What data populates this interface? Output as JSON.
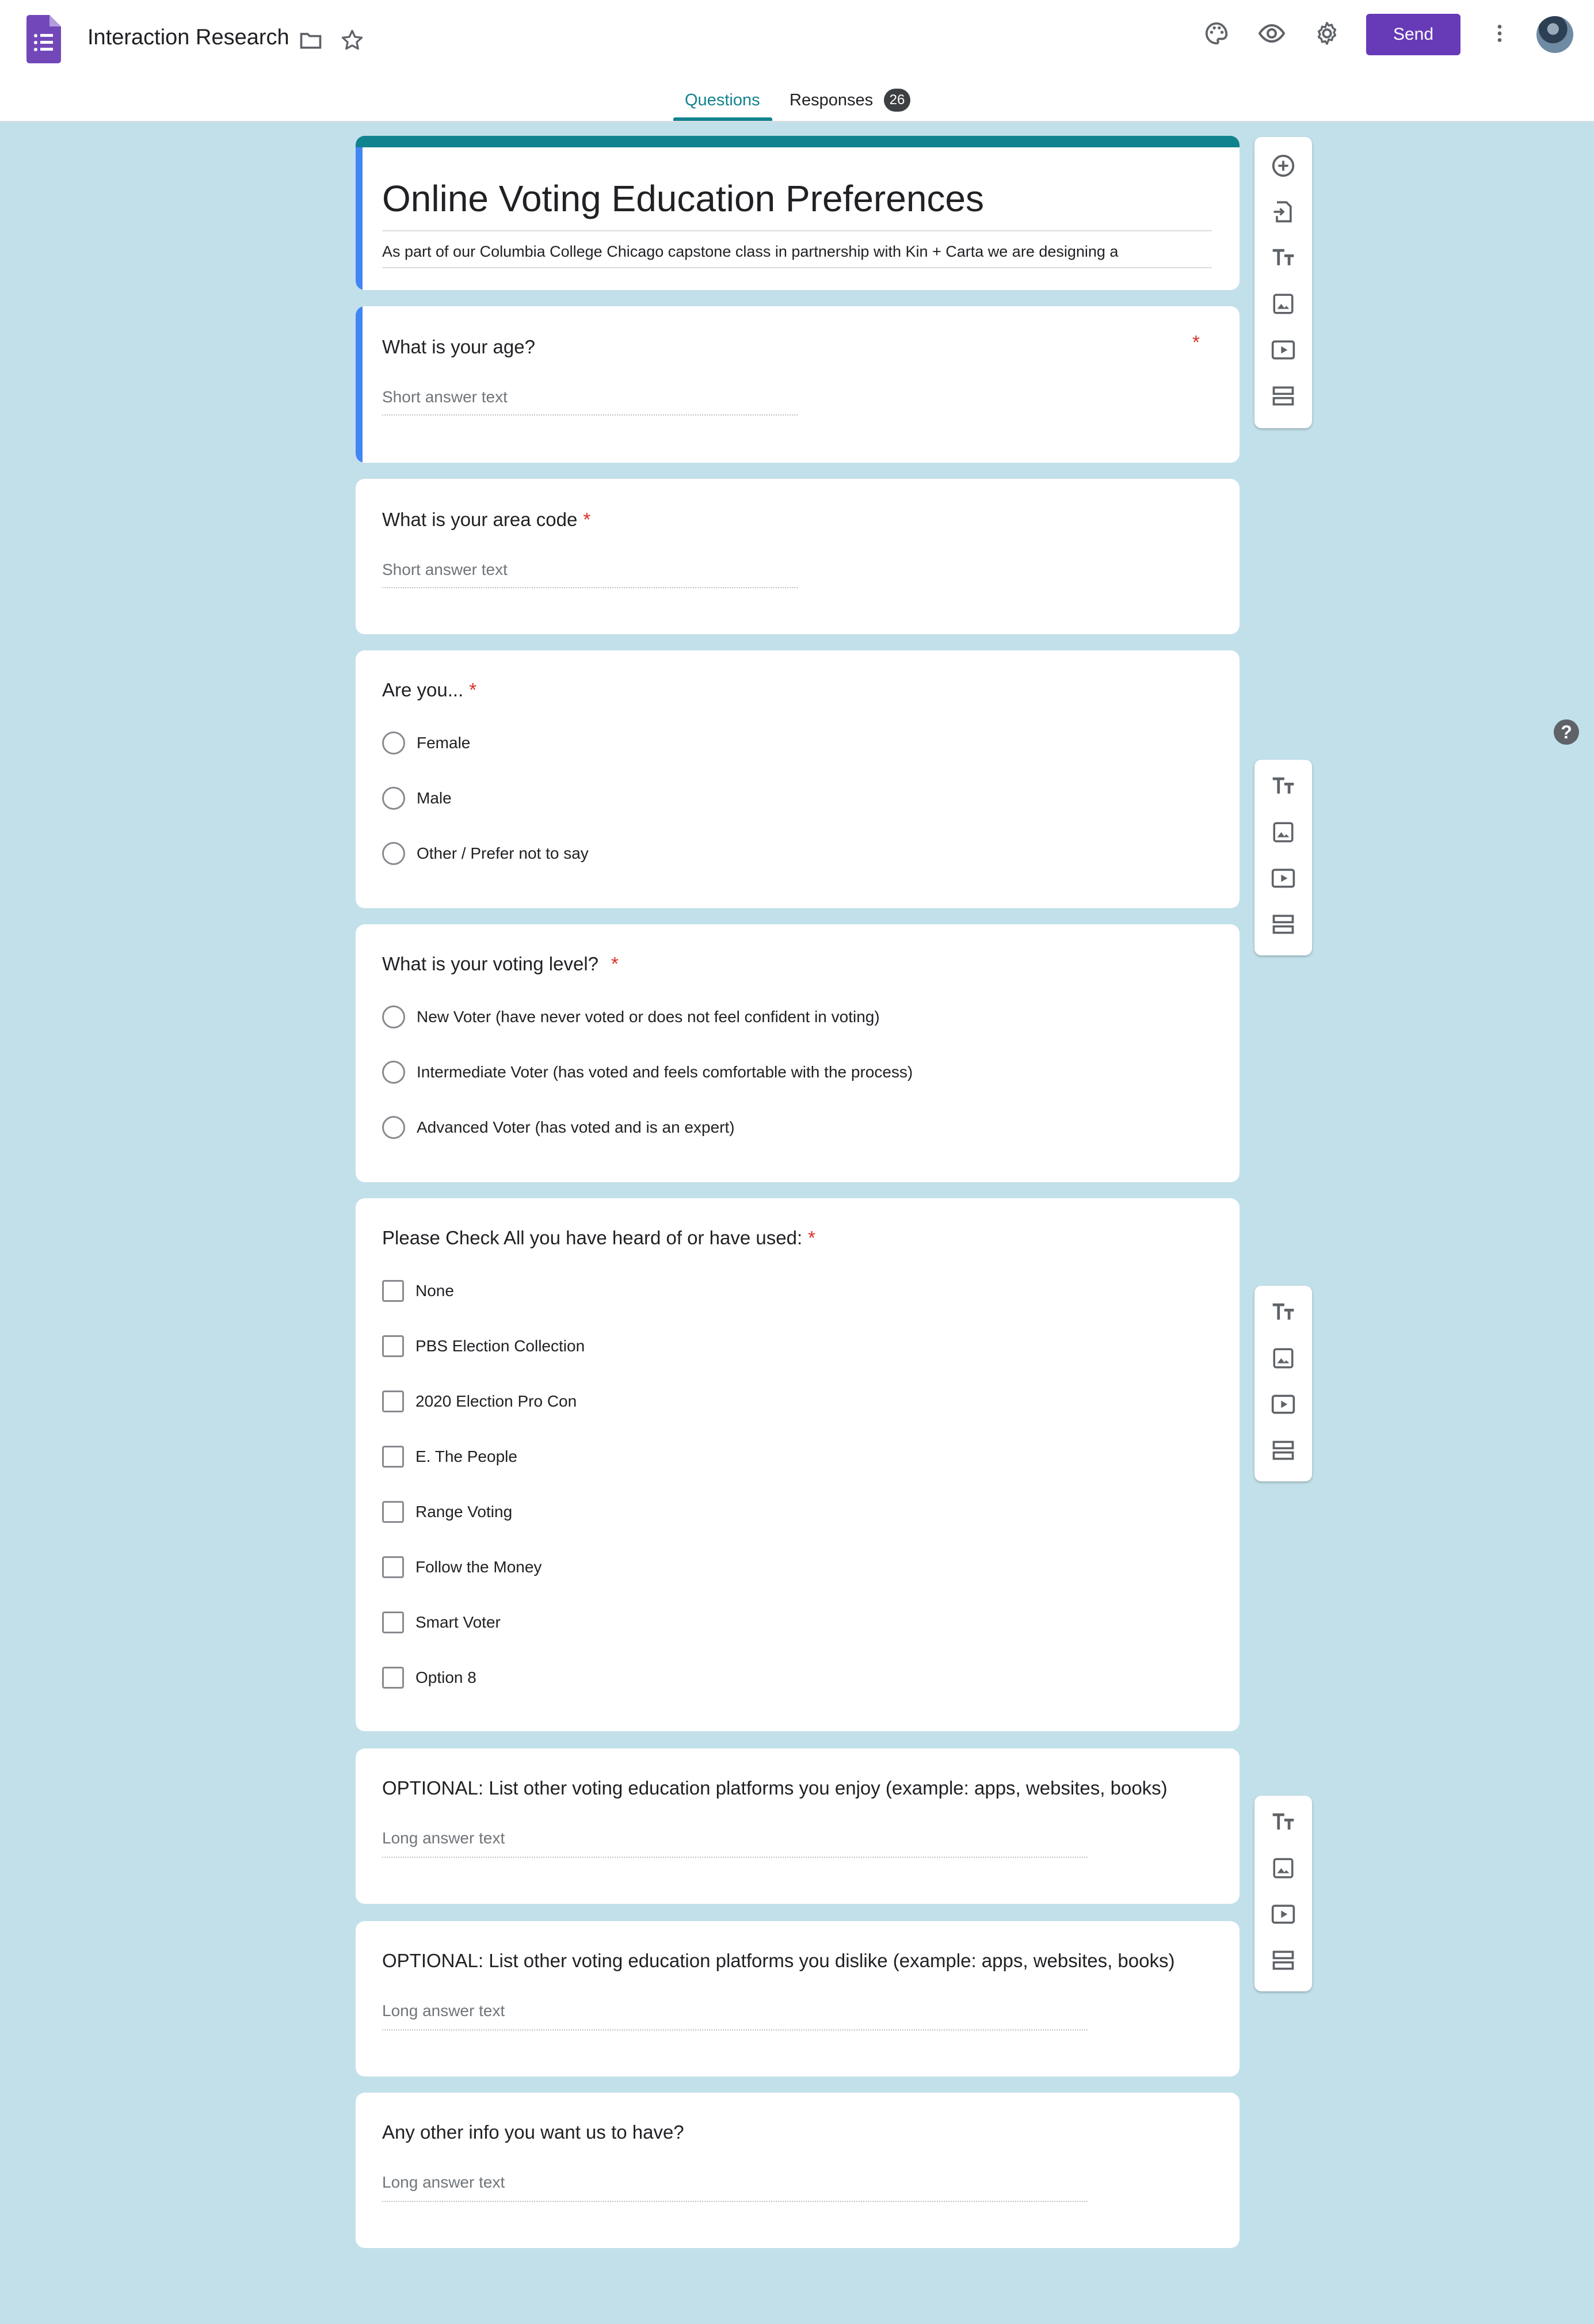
{
  "header": {
    "doc_title": "Interaction Research",
    "send_label": "Send",
    "icons": [
      "forms-logo-icon",
      "folder-icon",
      "star-icon",
      "palette-icon",
      "preview-eye-icon",
      "settings-gear-icon",
      "more-vert-icon"
    ]
  },
  "tabs": {
    "questions": "Questions",
    "responses": "Responses",
    "responses_count": "26"
  },
  "form": {
    "title": "Online Voting Education Preferences",
    "description": "As part of our Columbia College Chicago capstone class in partnership with Kin + Carta we are designing a"
  },
  "questions": [
    {
      "title": "What is your age?",
      "required": "*",
      "placeholder": "Short answer text"
    },
    {
      "title": "What is your area code",
      "required": "*",
      "placeholder": "Short answer text"
    },
    {
      "title": "Are you...",
      "required": "*",
      "options": [
        "Female",
        "Male",
        "Other / Prefer not to say"
      ]
    },
    {
      "title": "What is your voting level?",
      "required": "*",
      "options": [
        "New Voter (have never voted  or does not feel confident in voting)",
        "Intermediate Voter (has voted and feels comfortable with the process)",
        "Advanced Voter (has voted and is an expert)"
      ]
    },
    {
      "title": "Please Check All you have heard of or have used:",
      "required": "*",
      "options": [
        "None",
        "PBS Election Collection",
        "2020 Election Pro Con",
        "E. The People",
        "Range Voting",
        "Follow the Money",
        "Smart Voter",
        "Option 8"
      ]
    },
    {
      "title": "OPTIONAL: List other voting education platforms you enjoy (example: apps, websites, books)",
      "placeholder": "Long answer text"
    },
    {
      "title": "OPTIONAL: List other voting education platforms you dislike (example: apps, websites, books)",
      "placeholder": "Long answer text"
    },
    {
      "title": "Any other info you want us to have?",
      "placeholder": "Long answer text"
    }
  ],
  "help_label": "?",
  "colors": {
    "background": "#c2e0ea",
    "accent": "#673ab7",
    "theme": "#11838e",
    "active_border": "#4285f4",
    "required": "#d93025"
  }
}
